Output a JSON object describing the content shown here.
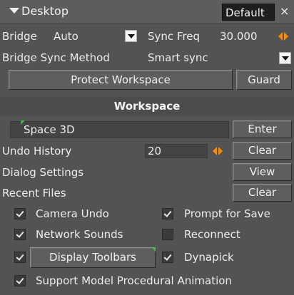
{
  "header": {
    "title": "Desktop",
    "layout": "Default",
    "close": "×"
  },
  "bridge": {
    "label": "Bridge",
    "value": "Auto",
    "sync_freq_label": "Sync Freq",
    "sync_freq_value": "30.000"
  },
  "sync_method": {
    "label": "Bridge Sync Method",
    "value": "Smart sync"
  },
  "buttons": {
    "protect_workspace": "Protect Workspace",
    "guard": "Guard"
  },
  "workspace": {
    "header": "Workspace",
    "space_label": "Space 3D",
    "enter": "Enter",
    "undo_history_label": "Undo History",
    "undo_history_value": "20",
    "undo_clear": "Clear",
    "dialog_settings_label": "Dialog Settings",
    "view": "View",
    "recent_files_label": "Recent Files",
    "recent_clear": "Clear"
  },
  "options": {
    "camera_undo": {
      "label": "Camera Undo",
      "checked": true
    },
    "prompt_for_save": {
      "label": "Prompt for Save",
      "checked": true
    },
    "network_sounds": {
      "label": "Network Sounds",
      "checked": true
    },
    "reconnect": {
      "label": "Reconnect",
      "checked": false
    },
    "display_toolbars": {
      "label": "Display Toolbars",
      "checked": true
    },
    "dynapick": {
      "label": "Dynapick",
      "checked": true
    },
    "support_model": {
      "label": "Support Model Procedural Animation",
      "checked": true
    }
  },
  "colors": {
    "background": "#535353",
    "accent_orange": "#ff8a00",
    "marker_green": "#36c23a"
  }
}
